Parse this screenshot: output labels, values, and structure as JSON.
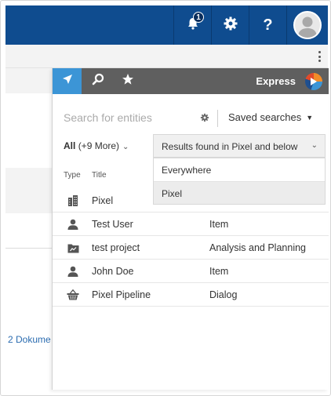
{
  "topbar": {
    "notifications_count": "1",
    "help_label": "?",
    "icons": [
      "bell-icon",
      "gear-icon",
      "help-icon",
      "user-avatar-icon"
    ],
    "background_color": "#0f4c8f"
  },
  "background_page": {
    "link_text": "2 Dokume"
  },
  "panel": {
    "tabs": [
      {
        "icon": "navigate-arrow-icon",
        "active": true
      },
      {
        "icon": "search-icon",
        "active": false
      },
      {
        "icon": "star-icon",
        "active": false
      }
    ],
    "product_name": "Express",
    "accent_color": "#3c95d6"
  },
  "search": {
    "placeholder": "Search for entities",
    "value": "",
    "saved_searches_label": "Saved searches"
  },
  "filters": {
    "all_label": "All",
    "all_more": "(+9 More)",
    "scope_selected": "Results found in Pixel and below",
    "scope_options": [
      "Everywhere",
      "Pixel"
    ]
  },
  "columns": {
    "type": "Type",
    "title": "Title"
  },
  "results": [
    {
      "icon": "building-icon",
      "title": "Pixel",
      "kind": ""
    },
    {
      "icon": "user-icon",
      "title": "Test User",
      "kind": "Item"
    },
    {
      "icon": "project-folder-icon",
      "title": "test project",
      "kind": "Analysis and Planning"
    },
    {
      "icon": "user-icon",
      "title": "John Doe",
      "kind": "Item"
    },
    {
      "icon": "basket-icon",
      "title": "Pixel Pipeline",
      "kind": "Dialog"
    }
  ]
}
